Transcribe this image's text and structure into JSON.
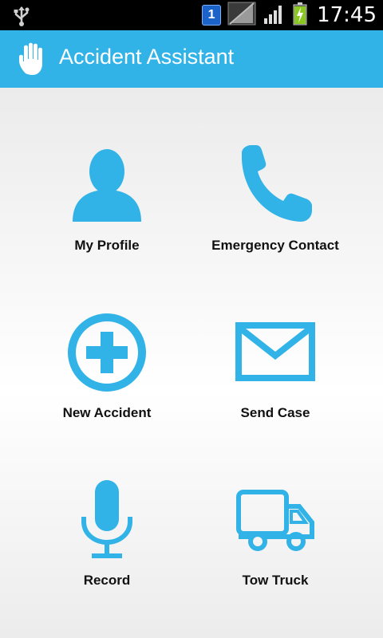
{
  "status_bar": {
    "time": "17:45",
    "notification_badge": "1"
  },
  "app_bar": {
    "title": "Accident Assistant",
    "icon": "hand-icon"
  },
  "menu": [
    {
      "label": "My Profile",
      "icon": "person-icon"
    },
    {
      "label": "Emergency Contact",
      "icon": "phone-icon"
    },
    {
      "label": "New Accident",
      "icon": "plus-circle-icon"
    },
    {
      "label": "Send Case",
      "icon": "envelope-icon"
    },
    {
      "label": "Record",
      "icon": "microphone-icon"
    },
    {
      "label": "Tow Truck",
      "icon": "truck-icon"
    }
  ],
  "colors": {
    "accent": "#31b3e7",
    "status_bar": "#000000",
    "label": "#111111"
  }
}
